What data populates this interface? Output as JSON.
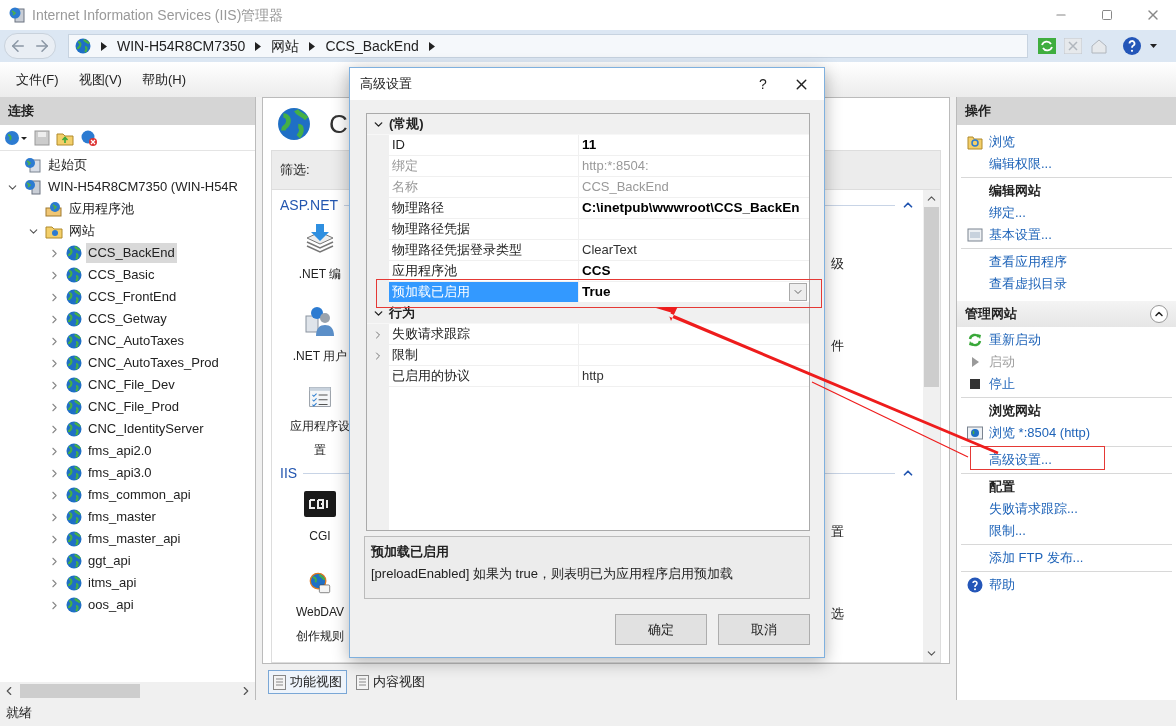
{
  "window": {
    "title": "Internet Information Services (IIS)管理器"
  },
  "address_bar": {
    "breadcrumbs": [
      "WIN-H54R8CM7350",
      "网站",
      "CCS_BackEnd"
    ]
  },
  "menu": [
    "文件(F)",
    "视图(V)",
    "帮助(H)"
  ],
  "connections": {
    "title": "连接",
    "tree": [
      {
        "label": "起始页",
        "kind": "start_page",
        "selected": false
      },
      {
        "label": "WIN-H54R8CM7350 (WIN-H54R",
        "kind": "server",
        "expanded": true,
        "selected": false,
        "children": [
          {
            "label": "应用程序池",
            "kind": "app_pools",
            "selected": false
          },
          {
            "label": "网站",
            "kind": "sites",
            "expanded": true,
            "selected": false,
            "children": [
              {
                "label": "CCS_BackEnd",
                "kind": "site",
                "expanded": false,
                "selected": true
              },
              {
                "label": "CCS_Basic",
                "kind": "site",
                "expanded": false,
                "selected": false
              },
              {
                "label": "CCS_FrontEnd",
                "kind": "site",
                "expanded": false,
                "selected": false
              },
              {
                "label": "CCS_Getway",
                "kind": "site",
                "expanded": false,
                "selected": false
              },
              {
                "label": "CNC_AutoTaxes",
                "kind": "site",
                "expanded": false,
                "selected": false
              },
              {
                "label": "CNC_AutoTaxes_Prod",
                "kind": "site",
                "expanded": false,
                "selected": false
              },
              {
                "label": "CNC_File_Dev",
                "kind": "site",
                "expanded": false,
                "selected": false
              },
              {
                "label": "CNC_File_Prod",
                "kind": "site",
                "expanded": false,
                "selected": false
              },
              {
                "label": "CNC_IdentityServer",
                "kind": "site",
                "expanded": false,
                "selected": false
              },
              {
                "label": "fms_api2.0",
                "kind": "site",
                "expanded": false,
                "selected": false
              },
              {
                "label": "fms_api3.0",
                "kind": "site",
                "expanded": false,
                "selected": false
              },
              {
                "label": "fms_common_api",
                "kind": "site",
                "expanded": false,
                "selected": false
              },
              {
                "label": "fms_master",
                "kind": "site",
                "expanded": false,
                "selected": false
              },
              {
                "label": "fms_master_api",
                "kind": "site",
                "expanded": false,
                "selected": false
              },
              {
                "label": "ggt_api",
                "kind": "site",
                "expanded": false,
                "selected": false
              },
              {
                "label": "itms_api",
                "kind": "site",
                "expanded": false,
                "selected": false
              },
              {
                "label": "oos_api",
                "kind": "site",
                "expanded": false,
                "selected": false
              }
            ]
          }
        ]
      }
    ]
  },
  "features": {
    "title": "C",
    "filter_label": "筛选:",
    "groups": [
      {
        "title": "ASP.NET",
        "expanded": true,
        "rows": [
          {
            "label": ".NET 编",
            "kind": "compile",
            "column_2": "级"
          },
          {
            "label": ".NET 用户",
            "kind": "users",
            "column_2": "件"
          },
          {
            "label": "应用程序设置",
            "kind": "settings"
          }
        ]
      },
      {
        "title": "IIS",
        "expanded": true,
        "rows": [
          {
            "label": "CGI",
            "kind": "cgi",
            "column_2": "置"
          },
          {
            "label": "WebDAV 创作规则",
            "kind": "webdav",
            "column_2": "选"
          }
        ]
      }
    ]
  },
  "view_tabs": [
    {
      "label": "功能视图",
      "selected": true
    },
    {
      "label": "内容视图",
      "selected": false
    }
  ],
  "dialog": {
    "title": "高级设置",
    "help": "?",
    "categories": [
      {
        "label": "(常规)",
        "expanded": true,
        "rows": [
          {
            "kind": "property",
            "name": "ID",
            "value": "11",
            "emphasized": true,
            "disabled": false,
            "selected": false
          },
          {
            "kind": "property",
            "name": "绑定",
            "value": "http:*:8504:",
            "emphasized": false,
            "disabled": true,
            "selected": false
          },
          {
            "kind": "property",
            "name": "名称",
            "value": "CCS_BackEnd",
            "emphasized": false,
            "disabled": true,
            "selected": false
          },
          {
            "kind": "property",
            "name": "物理路径",
            "value": "C:\\inetpub\\wwwroot\\CCS_BackEn",
            "emphasized": true,
            "disabled": false,
            "selected": false
          },
          {
            "kind": "property",
            "name": "物理路径凭据",
            "disabled": false,
            "selected": false
          },
          {
            "kind": "property",
            "name": "物理路径凭据登录类型",
            "value": "ClearText",
            "emphasized": false,
            "disabled": false,
            "selected": false
          },
          {
            "kind": "property",
            "name": "应用程序池",
            "value": "CCS",
            "emphasized": true,
            "disabled": false,
            "selected": false
          },
          {
            "kind": "property",
            "name": "预加载已启用",
            "value": "True",
            "emphasized": true,
            "disabled": false,
            "selected": true
          }
        ]
      },
      {
        "label": "行为",
        "expanded": true,
        "rows": [
          {
            "kind": "group",
            "name": "失败请求跟踪",
            "expanded": false,
            "disabled": false,
            "selected": false
          },
          {
            "kind": "group",
            "name": "限制",
            "expanded": false,
            "disabled": false,
            "selected": false
          },
          {
            "kind": "property",
            "name": "已启用的协议",
            "value": "http",
            "emphasized": false,
            "disabled": false,
            "selected": false
          }
        ]
      }
    ],
    "description": {
      "title": "预加载已启用",
      "text": "[preloadEnabled] 如果为 true，则表明已为应用程序启用预加载"
    },
    "buttons": [
      "确定",
      "取消"
    ]
  },
  "actions": {
    "title": "操作",
    "blocks": [
      {
        "kind": "group",
        "items": [
          {
            "label": "浏览",
            "kind": "browse",
            "disabled": false
          },
          {
            "label": "编辑权限...",
            "kind": "link",
            "disabled": false
          }
        ]
      },
      {
        "kind": "group",
        "heading": "编辑网站",
        "items": [
          {
            "label": "绑定...",
            "kind": "link",
            "disabled": false
          },
          {
            "label": "基本设置...",
            "kind": "settings",
            "disabled": false
          }
        ]
      },
      {
        "kind": "group",
        "items": [
          {
            "label": "查看应用程序",
            "kind": "link",
            "disabled": false
          },
          {
            "label": "查看虚拟目录",
            "kind": "link",
            "disabled": false
          }
        ]
      },
      {
        "kind": "section",
        "heading": "管理网站",
        "expanded": true
      },
      {
        "kind": "group",
        "items": [
          {
            "label": "重新启动",
            "kind": "restart",
            "disabled": false
          },
          {
            "label": "启动",
            "kind": "start",
            "disabled": true
          },
          {
            "label": "停止",
            "kind": "stop",
            "disabled": false
          }
        ]
      },
      {
        "kind": "group",
        "heading": "浏览网站",
        "items": [
          {
            "label": "浏览 *:8504 (http)",
            "kind": "site",
            "disabled": false
          }
        ]
      },
      {
        "kind": "group",
        "items": [
          {
            "label": "高级设置...",
            "kind": "link",
            "disabled": false
          }
        ]
      },
      {
        "kind": "group",
        "heading": "配置",
        "items": [
          {
            "label": "失败请求跟踪...",
            "kind": "link",
            "disabled": false
          },
          {
            "label": "限制...",
            "kind": "link",
            "disabled": false
          }
        ]
      },
      {
        "kind": "group",
        "items": [
          {
            "label": "添加 FTP 发布...",
            "kind": "link",
            "disabled": false
          }
        ]
      },
      {
        "kind": "group",
        "items": [
          {
            "label": "帮助",
            "kind": "help",
            "disabled": false
          }
        ]
      }
    ]
  },
  "status_bar": "就绪"
}
